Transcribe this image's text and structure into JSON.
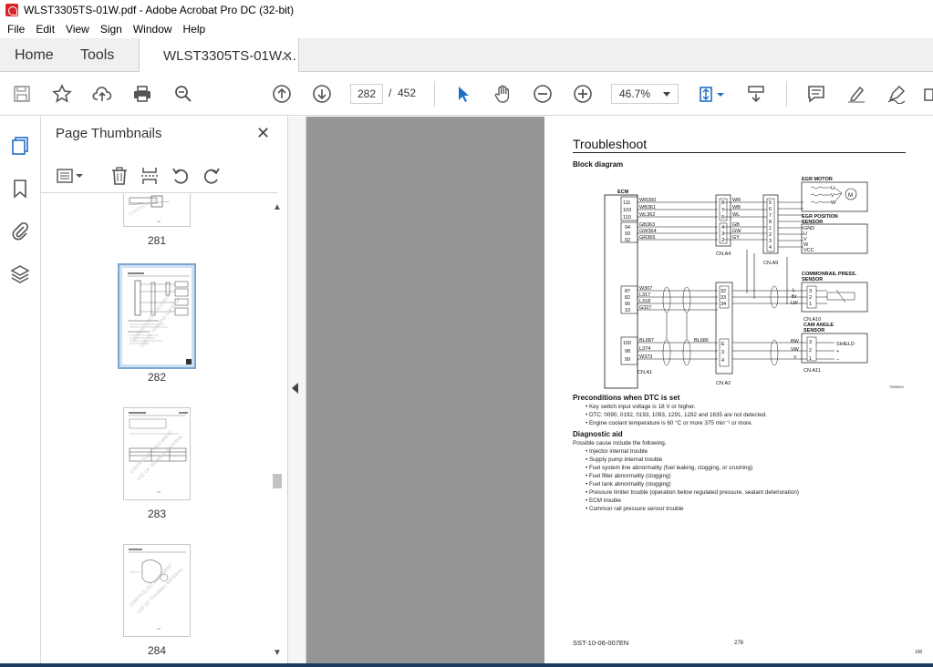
{
  "window": {
    "title": "WLST3305TS-01W.pdf - Adobe Acrobat Pro DC (32-bit)"
  },
  "menu": [
    "File",
    "Edit",
    "View",
    "Sign",
    "Window",
    "Help"
  ],
  "tabs": {
    "home": "Home",
    "tools": "Tools",
    "doc": "WLST3305TS-01W...."
  },
  "toolbar": {
    "page_current": "282",
    "page_sep": "/",
    "page_total": "452",
    "zoom": "46.7%"
  },
  "panel": {
    "title": "Page Thumbnails"
  },
  "thumbnails": [
    {
      "label": "281",
      "selected": false
    },
    {
      "label": "282",
      "selected": true
    },
    {
      "label": "283",
      "selected": false
    },
    {
      "label": "284",
      "selected": false
    }
  ],
  "doc": {
    "title": "Troubleshoot",
    "block_label": "Block diagram",
    "ref_code": "TIM0829",
    "diagram": {
      "ecm": "ECM",
      "egr_motor": "EGR MOTOR",
      "egr_position": [
        "EGR POSITION",
        "SENSOR"
      ],
      "commonrail": [
        "COMMONRAIL PRESS.",
        "SENSOR"
      ],
      "cam_angle": [
        "CAM ANGLE",
        "SENSOR"
      ],
      "shield": "SHIELD",
      "ecm_pins_1": [
        "111",
        "103",
        "110"
      ],
      "ecm_pins_2": [
        "94",
        "93",
        "92"
      ],
      "ecm_pins_3": [
        "87",
        "82",
        "90",
        "10"
      ],
      "ecm_pins_4": [
        "100",
        "98",
        "99"
      ],
      "wires_1": [
        "WR360",
        "WB361",
        "WL362"
      ],
      "wires_2": [
        "GB363",
        "GW364",
        "GR365"
      ],
      "wires_3": [
        "W307",
        "L317",
        "L318",
        "G327"
      ],
      "wires_4": [
        "BL687",
        "L374",
        "W373"
      ],
      "bl686": "BL686",
      "a4_pins_1": [
        "8",
        "7",
        "6"
      ],
      "a4_pins_2": [
        "4",
        "3",
        "2"
      ],
      "a4_codes_1": [
        "WR",
        "WB",
        "WL"
      ],
      "a4_codes_2": [
        "GB",
        "GW",
        "GY"
      ],
      "a9_pins": [
        "5",
        "6",
        "7",
        "8",
        "1",
        "2",
        "3",
        "4"
      ],
      "egr_uvw": [
        "U",
        "V",
        "W"
      ],
      "pos_labels": [
        "GND",
        "U",
        "V",
        "W",
        "VCC"
      ],
      "a2_pins_1": [
        "32",
        "33",
        "34"
      ],
      "a2_pins_2": [
        "E",
        "3",
        "4"
      ],
      "cr_codes": [
        "L",
        "Br",
        "LW"
      ],
      "cr_pins": [
        "3",
        "2",
        "1"
      ],
      "cam_codes": [
        "BW",
        "VW",
        "Y"
      ],
      "cam_pins": [
        "3",
        "2",
        "1"
      ],
      "cam_signs": [
        "+",
        "−",
        "+"
      ],
      "motor_symbol": "M",
      "cn_a1": "CN.A1",
      "cn_a2": "CN.A2",
      "cn_a4": "CN.A4",
      "cn_a9": "CN.A9",
      "cn_a10": "CN.A10",
      "cn_a11": "CN.A11"
    },
    "preconditions_title": "Preconditions when DTC is set",
    "preconditions": [
      "Key switch input voltage is 18 V or higher.",
      "DTC: 0090, 0192, 0193, 1093, 1291, 1292 and 1635 are not detected.",
      "Engine coolant temperature is 60 °C or more 375 min⁻¹ or more."
    ],
    "diag_title": "Diagnostic aid",
    "diag_intro": "Possible cause include the following.",
    "causes": [
      "Injector internal trouble",
      "Supply pump internal trouble",
      "Fuel system line abnormality (fuel leaking, clogging, or crushing)",
      "Fuel filter abnormality (clogging)",
      "Fuel tank abnormality (clogging)",
      "Pressure limiter trouble (operation below regulated pressure, sealant deterioration)",
      "ECM trouble",
      "Common rail pressure sensor trouble"
    ],
    "footer_left": "SST-10-06-007EN",
    "footer_mid": "278",
    "footer_right": "190"
  }
}
